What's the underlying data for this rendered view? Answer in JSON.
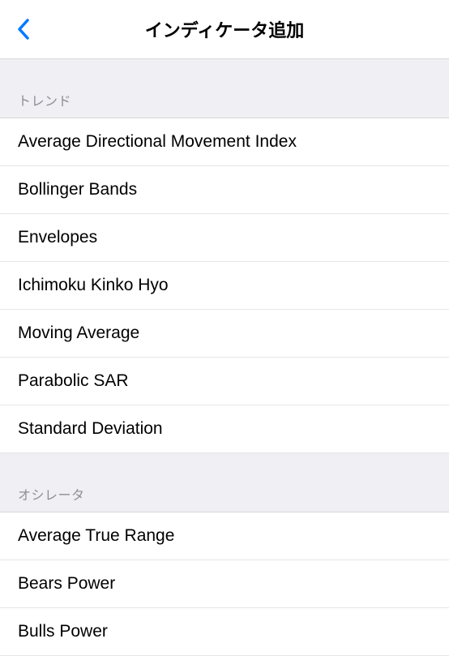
{
  "header": {
    "title": "インディケータ追加"
  },
  "sections": [
    {
      "header": "トレンド",
      "items": [
        "Average Directional Movement Index",
        "Bollinger Bands",
        "Envelopes",
        "Ichimoku Kinko Hyo",
        "Moving Average",
        "Parabolic SAR",
        "Standard Deviation"
      ]
    },
    {
      "header": "オシレータ",
      "items": [
        "Average True Range",
        "Bears Power",
        "Bulls Power"
      ]
    }
  ]
}
